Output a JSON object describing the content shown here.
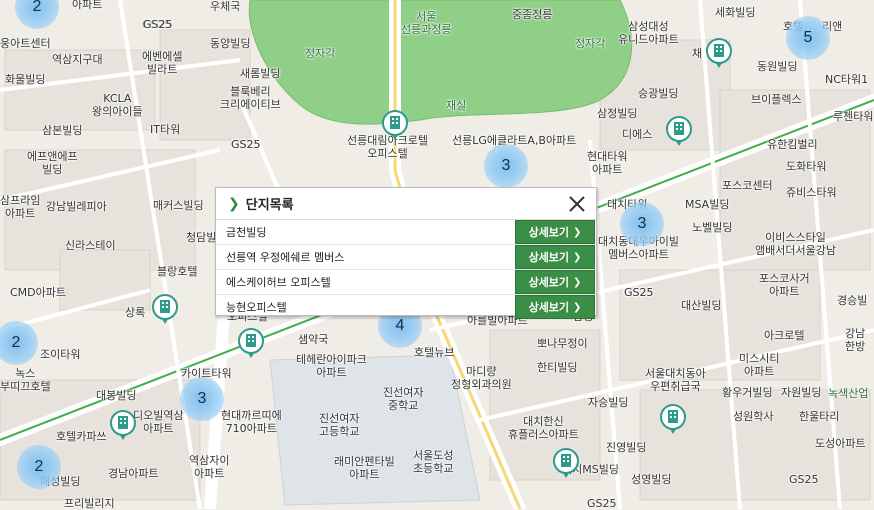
{
  "popup": {
    "title": "단지목록",
    "items": [
      {
        "name": "금천빌딩",
        "button": "상세보기"
      },
      {
        "name": "선릉역 우정에쉐르 멤버스",
        "button": "상세보기"
      },
      {
        "name": "에스케이허브 오피스텔",
        "button": "상세보기"
      },
      {
        "name": "능현오피스텔",
        "button": "상세보기"
      }
    ]
  },
  "clusters": [
    "2",
    "5",
    "3",
    "3",
    "2",
    "4",
    "3",
    "2"
  ],
  "labels": [
    "아파트",
    "우체국",
    "중종정릉",
    "삼성대성\n유니드아파트",
    "세화빌딩",
    "호텔",
    "리앤",
    "웅아트센터",
    "역삼지구대",
    "에벤에셀\n빌라트",
    "동양빌딩",
    "서울\n선릉과정릉",
    "정자각",
    "정자각",
    "채",
    "NC타워1",
    "동원빌딩",
    "화물빌딩",
    "새롬빌딩",
    "KCLA\n왕의아이들",
    "블룩베리\n크리에이티브",
    "승광빌딩",
    "브이플렉스",
    "삼본빌딩",
    "IT타워",
    "재실",
    "삼정빌딩",
    "루첸타워",
    "에프앤에프\n빌딩",
    "GS25",
    "선릉대림아크로텔\n오피스텔",
    "선릉LG에클라트A,B아파트",
    "현대타워\n아파트",
    "디에스",
    "유한킴벌리",
    "도화타워",
    "삼프라임\n아파트",
    "강남빌레피아",
    "매커스빌딩",
    "포스코센터",
    "쥬비스타워",
    "대치타워",
    "MSA빌딩",
    "노벨빌딩",
    "신라스테이",
    "청담빌",
    "대치동대우아이빌\n멤버스아파트",
    "이비스스타일\n앰배서더서울강남",
    "CMD아파트",
    "블랑호텔",
    "GS25",
    "포스코사거\n아파트",
    "경승빌",
    "대산빌딩",
    "강남\n한방",
    "상록",
    "아크로텔",
    "조이타워",
    "오피스텔",
    "샘약국",
    "아를빌아파트",
    "삼성",
    "호텔뉴브",
    "뽀나무정이",
    "미스시티\n아파트",
    "녹스\n부띠끄호텔",
    "카이트타워",
    "테헤란아이파크\n아파트",
    "마디량\n정형외과의원",
    "한티빌딩",
    "서울대치동아\n우편취급국",
    "대봉빌딩",
    "진선여자\n중학교",
    "현대까르띠에\n710아파트",
    "디오빌역삼\n아파트",
    "진선여자\n고등학교",
    "황우거빌딩",
    "자원빌딩",
    "녹색산업",
    "자승빌딩",
    "성원학사",
    "한울타리",
    "호텔카파쓰",
    "대치한신\n휴플러스아파트",
    "도성아파트",
    "진영빌딩",
    "역삼자이\n아파트",
    "래미안펜타빌\n아파트",
    "서울도성\n초등학교",
    "경남아파트",
    "대치MS빌딩",
    "성영빌딩",
    "GS25",
    "애성빌딩",
    "프리빌리지",
    "GS25",
    "GS25",
    "GS25",
    "GS25",
    "GS25"
  ]
}
